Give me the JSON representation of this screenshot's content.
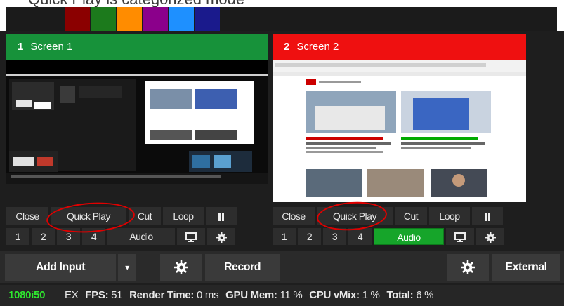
{
  "swatches": [
    "#8b0000",
    "#1c7a1c",
    "#ff8c00",
    "#8b008b",
    "#1e90ff",
    "#1a1a8c"
  ],
  "top_caption": "Quick Play is categorized mode",
  "screens": [
    {
      "number": "1",
      "title": "Screen 1",
      "header_color": "#17923a",
      "controls": {
        "close": "Close",
        "quick_play": "Quick Play",
        "cut": "Cut",
        "loop": "Loop",
        "audio": "Audio",
        "audio_active": false,
        "channels": [
          "1",
          "2",
          "3",
          "4"
        ]
      }
    },
    {
      "number": "2",
      "title": "Screen 2",
      "header_color": "#ef1010",
      "controls": {
        "close": "Close",
        "quick_play": "Quick Play",
        "cut": "Cut",
        "loop": "Loop",
        "audio": "Audio",
        "audio_active": true,
        "channels": [
          "1",
          "2",
          "3",
          "4"
        ]
      }
    }
  ],
  "bottom": {
    "add_input": "Add Input",
    "dropdown": "▾",
    "record": "Record",
    "external": "External"
  },
  "status": {
    "resolution": "1080i50",
    "ex": "EX",
    "fps_label": "FPS:",
    "fps_value": "51",
    "render_label": "Render Time:",
    "render_value": "0 ms",
    "gpu_label": "GPU Mem:",
    "gpu_value": "11 %",
    "cpu_label": "CPU vMix:",
    "cpu_value": "1 %",
    "total_label": "Total:",
    "total_value": "6 %"
  }
}
